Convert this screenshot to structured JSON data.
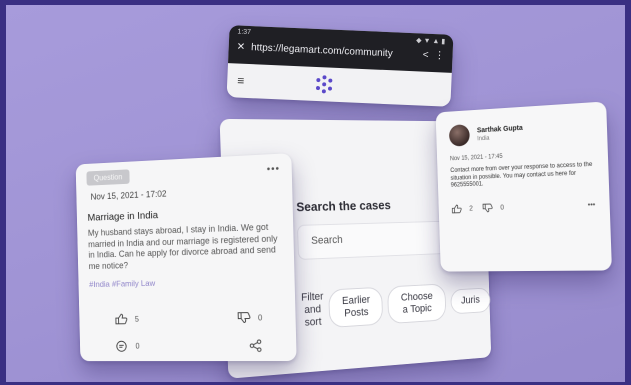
{
  "browser": {
    "time": "1:37",
    "status_icons": "◆ ▼ ▲ ▮",
    "close_glyph": "✕",
    "url": "https://legamart.com/community",
    "share_glyph": "<",
    "more_glyph": "⋮",
    "menu_glyph": "≡"
  },
  "search_card": {
    "title": "Search the cases",
    "search_placeholder": "Search",
    "filter_label": "Filter and sort",
    "chips": [
      "Earlier Posts",
      "Choose a Topic",
      "Juris"
    ]
  },
  "post": {
    "badge": "Question",
    "more": "•••",
    "date": "Nov 15, 2021 - 17:02",
    "title": "Marriage in India",
    "body": "My husband stays abroad, I stay in India. We got married in India and our marriage is registered only in India. Can he apply for divorce abroad and send me notice?",
    "tags": "#India #Family Law",
    "likes": "5",
    "dislikes": "0",
    "comments": "0"
  },
  "profile_card": {
    "name": "Sarthak Gupta",
    "subtitle": "India",
    "date": "Nov 15, 2021 - 17:45",
    "body": "Contact more from over your response to access to the situation in possible. You may contact us here for 9625555001.",
    "likes": "2",
    "dislikes": "0",
    "more": "•••"
  },
  "colors": {
    "background": "#3a2f83",
    "stage": "#a79bdb",
    "accent": "#5b49c9",
    "tag": "#8f84c9"
  }
}
